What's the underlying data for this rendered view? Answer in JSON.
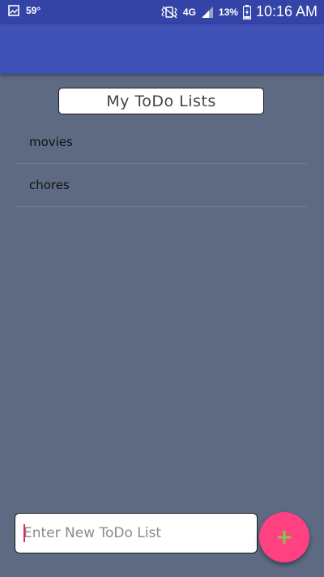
{
  "status_bar": {
    "temperature": "59°",
    "network": "4G",
    "battery": "13%",
    "time": "10:16 AM",
    "icons": [
      "gallery-icon",
      "vibrate-icon",
      "signal-icon",
      "battery-icon"
    ]
  },
  "title": "My ToDo Lists",
  "lists": [
    {
      "label": "movies"
    },
    {
      "label": "chores"
    }
  ],
  "new_list_input": {
    "placeholder": "Enter New ToDo List",
    "value": ""
  },
  "add_button": {
    "label": "+"
  },
  "colors": {
    "status_bar": "#3444a6",
    "app_bar": "#3f51b5",
    "background": "#5d6a82",
    "fab": "#ff4081",
    "fab_icon": "#8bc34a",
    "cursor": "#e91e63"
  }
}
